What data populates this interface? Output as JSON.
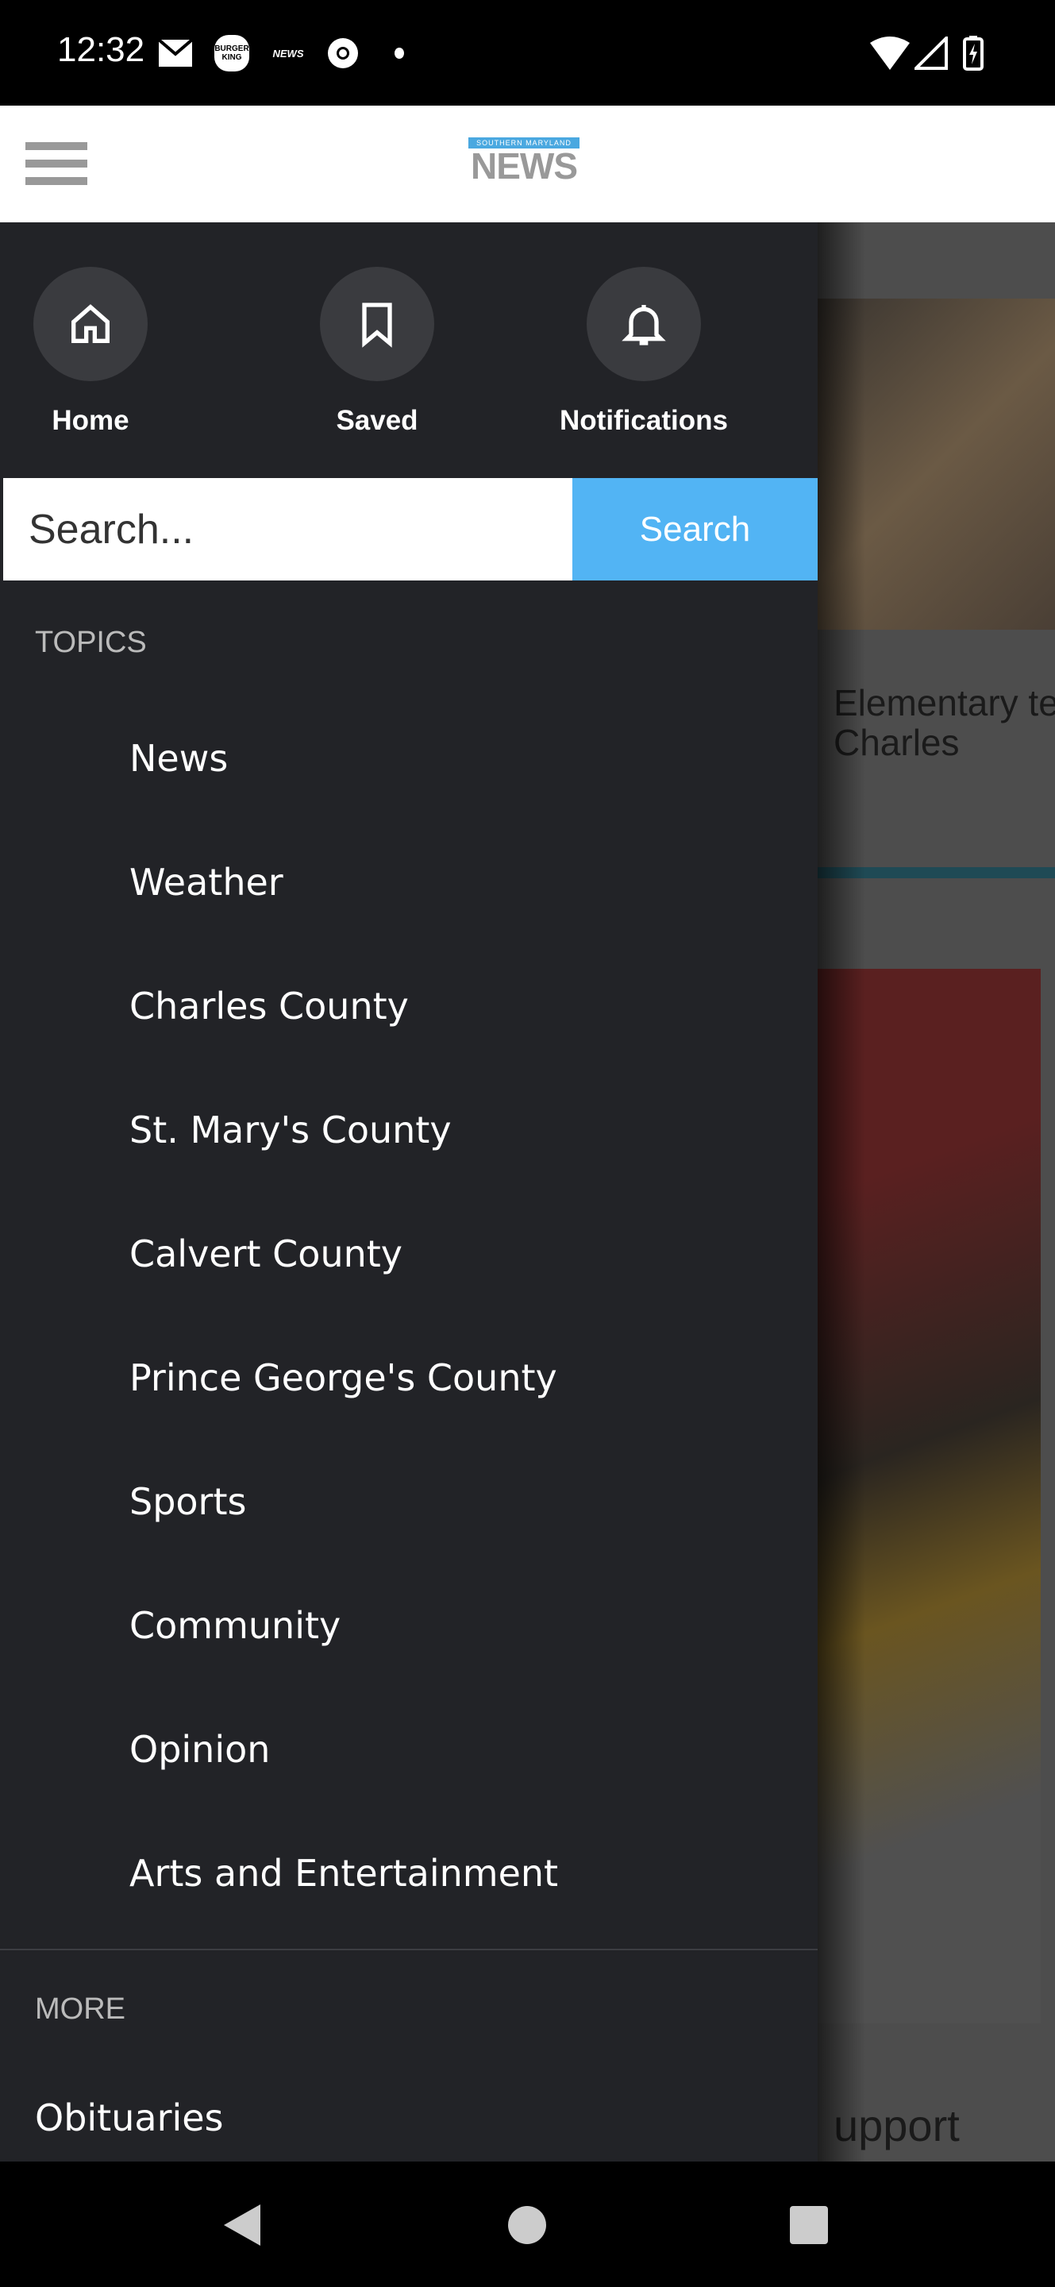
{
  "status_bar": {
    "time": "12:32",
    "left_icons": [
      "mail-icon",
      "burger-king-icon",
      "news-app-icon",
      "chrome-icon",
      "dot-icon"
    ],
    "right_icons": [
      "wifi-icon",
      "signal-icon",
      "battery-charging-icon"
    ],
    "burger_king": "BURGER KING",
    "news_app": "NEWS"
  },
  "header": {
    "logo_top": "SOUTHERN MARYLAND",
    "logo_main": "NEWS"
  },
  "drawer": {
    "quick": [
      {
        "label": "Home",
        "icon": "home-icon"
      },
      {
        "label": "Saved",
        "icon": "bookmark-icon"
      },
      {
        "label": "Notifications",
        "icon": "bell-icon"
      }
    ],
    "search": {
      "placeholder": "Search...",
      "button": "Search"
    },
    "topics_heading": "TOPICS",
    "topics": [
      "News",
      "Weather",
      "Charles County",
      "St. Mary's County",
      "Calvert County",
      "Prince George's County",
      "Sports",
      "Community",
      "Opinion",
      "Arts and Entertainment"
    ],
    "more_heading": "MORE",
    "more": [
      "Obituaries"
    ]
  },
  "background": {
    "headline_line1": "Elementary te",
    "headline_line2": "Charles",
    "headline2_fragment": "upport"
  },
  "colors": {
    "drawer": "#222327",
    "search_button": "#52b4f4"
  }
}
